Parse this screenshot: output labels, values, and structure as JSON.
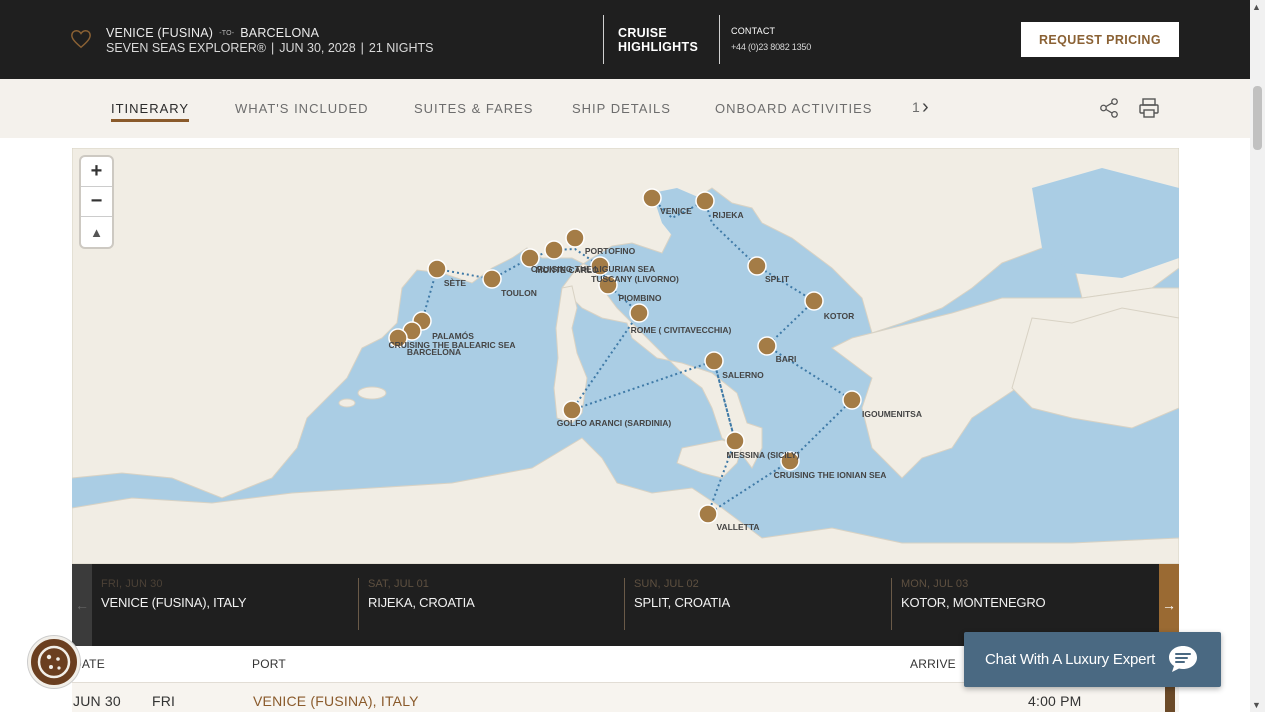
{
  "header": {
    "from_port": "VENICE (FUSINA)",
    "to_word": "-TO-",
    "to_port": "BARCELONA",
    "ship": "SEVEN SEAS EXPLORER®",
    "date": "JUN 30, 2028",
    "nights": "21 NIGHTS",
    "highlights_line1": "CRUISE",
    "highlights_line2": "HIGHLIGHTS",
    "contact_label": "CONTACT",
    "contact_phone": "+44 (0)23 8082 1350",
    "request_button": "REQUEST PRICING",
    "sep": "|"
  },
  "tabs": [
    {
      "label": "ITINERARY",
      "active": true
    },
    {
      "label": "WHAT'S INCLUDED",
      "active": false
    },
    {
      "label": "SUITES & FARES",
      "active": false
    },
    {
      "label": "SHIP DETAILS",
      "active": false
    },
    {
      "label": "ONBOARD ACTIVITIES",
      "active": false
    }
  ],
  "tab_overflow": "1",
  "tab_next": "›",
  "map": {
    "zoom_in": "+",
    "zoom_out": "−",
    "reset": "▲",
    "ports": [
      "VENICE",
      "RIJEKA",
      "SPLIT",
      "KOTOR",
      "BARI",
      "IGOUMENITSA",
      "CRUISING THE IONIAN SEA",
      "MESSINA (SICILY)",
      "VALLETTA",
      "SALERNO",
      "ROME ( CIVITAVECCHIA)",
      "GOLFO ARANCI (SARDINIA)",
      "PIOMBINO",
      "TUSCANY (LIVORNO)",
      "CRUISING THE LIGURIAN SEA",
      "PORTOFINO",
      "MONTE CARLO",
      "TOULON",
      "SÈTE",
      "PALAMÓS",
      "CRUISING THE BALEARIC SEA",
      "BARCELONA"
    ]
  },
  "carousel": {
    "prev": "←",
    "next": "→",
    "days": [
      {
        "date": "FRI, JUN 30",
        "port": "VENICE (FUSINA), ITALY"
      },
      {
        "date": "SAT, JUL 01",
        "port": "RIJEKA, CROATIA"
      },
      {
        "date": "SUN, JUL 02",
        "port": "SPLIT, CROATIA"
      },
      {
        "date": "MON, JUL 03",
        "port": "KOTOR, MONTENEGRO"
      }
    ]
  },
  "table": {
    "headers": {
      "date": "DATE",
      "port": "PORT",
      "arrive": "ARRIVE"
    },
    "rows": [
      {
        "date": "JUN 30",
        "day": "FRI",
        "port": "VENICE (FUSINA), ITALY",
        "time": "4:00 PM"
      }
    ]
  },
  "chat": {
    "label": "Chat With A Luxury Expert"
  },
  "colors": {
    "accent": "#8a5a2b",
    "dark": "#1f1f1f",
    "tabbar": "#f4f1ec",
    "sea": "#aacde4",
    "land": "#f1ede4",
    "marker": "#a47c46",
    "chat": "#4a6982"
  },
  "icons": [
    "heart-icon",
    "share-icon",
    "print-icon",
    "chat-bubble-icon",
    "cookie-icon"
  ]
}
